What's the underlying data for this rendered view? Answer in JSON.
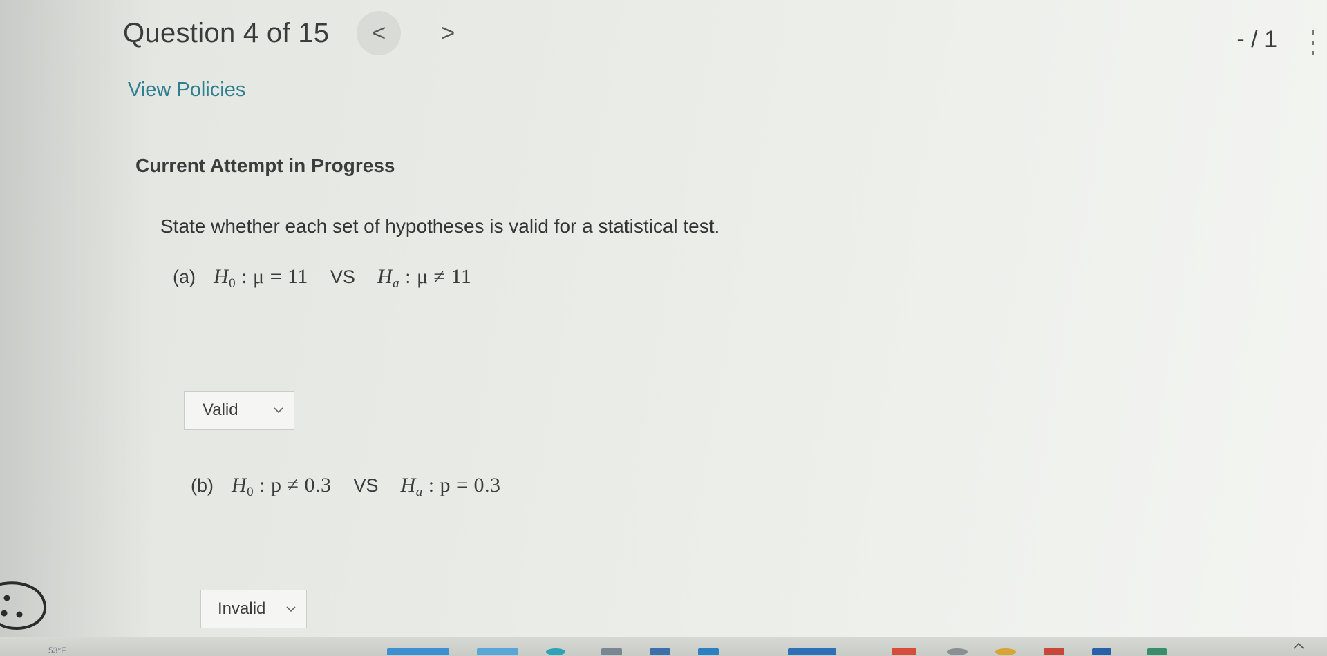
{
  "header": {
    "question_title": "Question 4 of 15",
    "prev_glyph": "<",
    "next_glyph": ">",
    "score": "- / 1"
  },
  "links": {
    "view_policies": "View Policies"
  },
  "attempt": {
    "status": "Current Attempt in Progress"
  },
  "question": {
    "prompt": "State whether each set of hypotheses is valid for a statistical test.",
    "parts": [
      {
        "label": "(a)",
        "h0": {
          "symbol": "H",
          "sub": "0",
          "rest": " : μ = 11"
        },
        "vs": "VS",
        "ha": {
          "symbol": "H",
          "sub": "a",
          "rest": " : μ ≠ 11"
        },
        "answer": "Valid"
      },
      {
        "label": "(b)",
        "h0": {
          "symbol": "H",
          "sub": "0",
          "rest": " : p ≠ 0.3"
        },
        "vs": "VS",
        "ha": {
          "symbol": "H",
          "sub": "a",
          "rest": " : p = 0.3"
        },
        "answer": "Invalid"
      }
    ]
  },
  "taskbar": {
    "weather": "53°F"
  },
  "colors": {
    "link": "#2f7f91",
    "text": "#3a3b3b",
    "background": "#e8eae6"
  },
  "icons": [
    "chevron-left-icon",
    "chevron-right-icon",
    "more-vertical-icon",
    "chevron-down-icon",
    "cookie-icon"
  ]
}
